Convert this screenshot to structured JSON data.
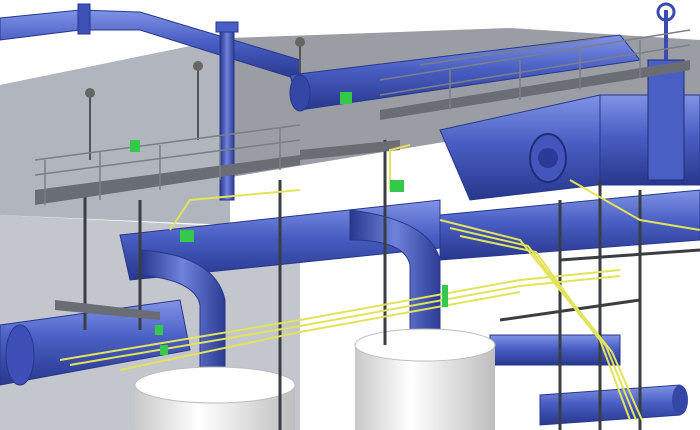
{
  "scene": {
    "colors": {
      "background": "#ffffff",
      "building_roof": "#9a9da4",
      "building_wall": "#b8bcc4",
      "pipe_blue": "#4a5fc4",
      "pipe_blue_dark": "#27378c",
      "pipe_blue_light": "#8093e6",
      "steel_dark": "#3a3d42",
      "railing": "#6f737a",
      "cable_yellow": "#e3e35a",
      "equipment_green": "#35c94a",
      "tank_white": "#f2f2f2",
      "tank_shadow": "#c9c9c9"
    },
    "icons": [
      "valve-icon",
      "flange-icon",
      "lamp-icon",
      "tank-icon",
      "junction-box-icon"
    ]
  }
}
